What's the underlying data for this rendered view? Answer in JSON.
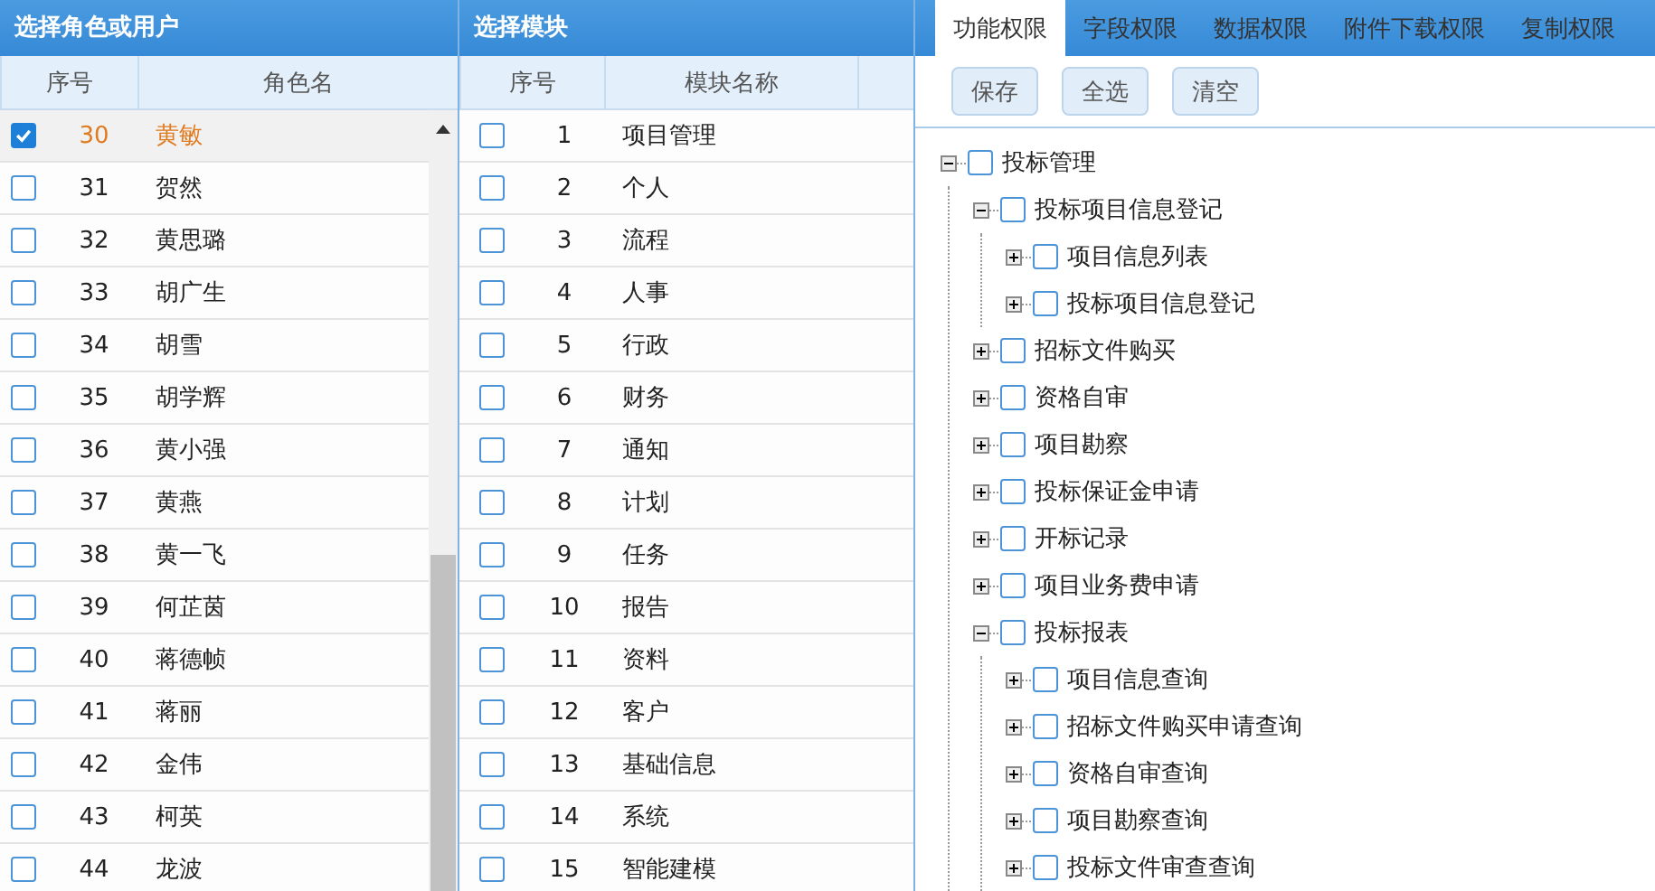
{
  "roles_panel": {
    "title": "选择角色或用户",
    "columns": [
      "序号",
      "角色名"
    ],
    "rows": [
      {
        "no": "30",
        "name": "黄敏",
        "checked": true,
        "selected": true
      },
      {
        "no": "31",
        "name": "贺然",
        "checked": false,
        "selected": false
      },
      {
        "no": "32",
        "name": "黄思璐",
        "checked": false,
        "selected": false
      },
      {
        "no": "33",
        "name": "胡广生",
        "checked": false,
        "selected": false
      },
      {
        "no": "34",
        "name": "胡雪",
        "checked": false,
        "selected": false
      },
      {
        "no": "35",
        "name": "胡学辉",
        "checked": false,
        "selected": false
      },
      {
        "no": "36",
        "name": "黄小强",
        "checked": false,
        "selected": false
      },
      {
        "no": "37",
        "name": "黄燕",
        "checked": false,
        "selected": false
      },
      {
        "no": "38",
        "name": "黄一飞",
        "checked": false,
        "selected": false
      },
      {
        "no": "39",
        "name": "何芷茵",
        "checked": false,
        "selected": false
      },
      {
        "no": "40",
        "name": "蒋德帧",
        "checked": false,
        "selected": false
      },
      {
        "no": "41",
        "name": "蒋丽",
        "checked": false,
        "selected": false
      },
      {
        "no": "42",
        "name": "金伟",
        "checked": false,
        "selected": false
      },
      {
        "no": "43",
        "name": "柯英",
        "checked": false,
        "selected": false
      },
      {
        "no": "44",
        "name": "龙波",
        "checked": false,
        "selected": false
      }
    ]
  },
  "modules_panel": {
    "title": "选择模块",
    "columns": [
      "序号",
      "模块名称"
    ],
    "rows": [
      {
        "no": "1",
        "name": "项目管理",
        "checked": false
      },
      {
        "no": "2",
        "name": "个人",
        "checked": false
      },
      {
        "no": "3",
        "name": "流程",
        "checked": false
      },
      {
        "no": "4",
        "name": "人事",
        "checked": false
      },
      {
        "no": "5",
        "name": "行政",
        "checked": false
      },
      {
        "no": "6",
        "name": "财务",
        "checked": false
      },
      {
        "no": "7",
        "name": "通知",
        "checked": false
      },
      {
        "no": "8",
        "name": "计划",
        "checked": false
      },
      {
        "no": "9",
        "name": "任务",
        "checked": false
      },
      {
        "no": "10",
        "name": "报告",
        "checked": false
      },
      {
        "no": "11",
        "name": "资料",
        "checked": false
      },
      {
        "no": "12",
        "name": "客户",
        "checked": false
      },
      {
        "no": "13",
        "name": "基础信息",
        "checked": false
      },
      {
        "no": "14",
        "name": "系统",
        "checked": false
      },
      {
        "no": "15",
        "name": "智能建模",
        "checked": false
      }
    ]
  },
  "permissions_panel": {
    "tabs": [
      {
        "label": "功能权限",
        "selected": true
      },
      {
        "label": "字段权限",
        "selected": false
      },
      {
        "label": "数据权限",
        "selected": false
      },
      {
        "label": "附件下载权限",
        "selected": false
      },
      {
        "label": "复制权限",
        "selected": false
      }
    ],
    "buttons": [
      "保存",
      "全选",
      "清空"
    ],
    "tree": [
      {
        "label": "投标管理",
        "checked": false,
        "expanded": true,
        "children": [
          {
            "label": "投标项目信息登记",
            "checked": false,
            "expanded": true,
            "children": [
              {
                "label": "项目信息列表",
                "checked": false,
                "expanded": false
              },
              {
                "label": "投标项目信息登记",
                "checked": false,
                "expanded": false
              }
            ]
          },
          {
            "label": "招标文件购买",
            "checked": false,
            "expanded": false
          },
          {
            "label": "资格自审",
            "checked": false,
            "expanded": false
          },
          {
            "label": "项目勘察",
            "checked": false,
            "expanded": false
          },
          {
            "label": "投标保证金申请",
            "checked": false,
            "expanded": false
          },
          {
            "label": "开标记录",
            "checked": false,
            "expanded": false
          },
          {
            "label": "项目业务费申请",
            "checked": false,
            "expanded": false
          },
          {
            "label": "投标报表",
            "checked": false,
            "expanded": true,
            "children": [
              {
                "label": "项目信息查询",
                "checked": false,
                "expanded": false
              },
              {
                "label": "招标文件购买申请查询",
                "checked": false,
                "expanded": false
              },
              {
                "label": "资格自审查询",
                "checked": false,
                "expanded": false
              },
              {
                "label": "项目勘察查询",
                "checked": false,
                "expanded": false
              },
              {
                "label": "投标文件审查查询",
                "checked": false,
                "expanded": false
              }
            ]
          }
        ]
      }
    ]
  }
}
